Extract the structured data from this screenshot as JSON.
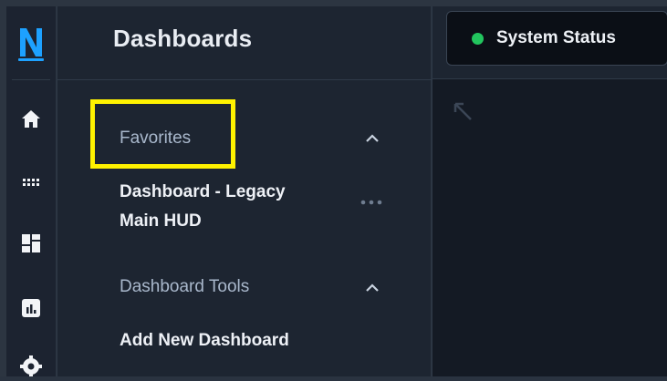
{
  "panel": {
    "title": "Dashboards",
    "sections": [
      {
        "label": "Favorites",
        "expanded": true,
        "items": [
          "Dashboard - Legacy",
          "Main HUD"
        ]
      },
      {
        "label": "Dashboard Tools",
        "expanded": true,
        "items": [
          "Add New Dashboard"
        ]
      }
    ]
  },
  "rail": {
    "logo_letter": "N",
    "icons": [
      "home-icon",
      "apps-grid-icon",
      "dashboard-layout-icon",
      "analytics-icon",
      "settings-icon"
    ]
  },
  "status": {
    "label": "System Status",
    "indicator_color": "#22c55e"
  },
  "colors": {
    "accent": "#1da1ff",
    "highlight": "#fff200"
  }
}
